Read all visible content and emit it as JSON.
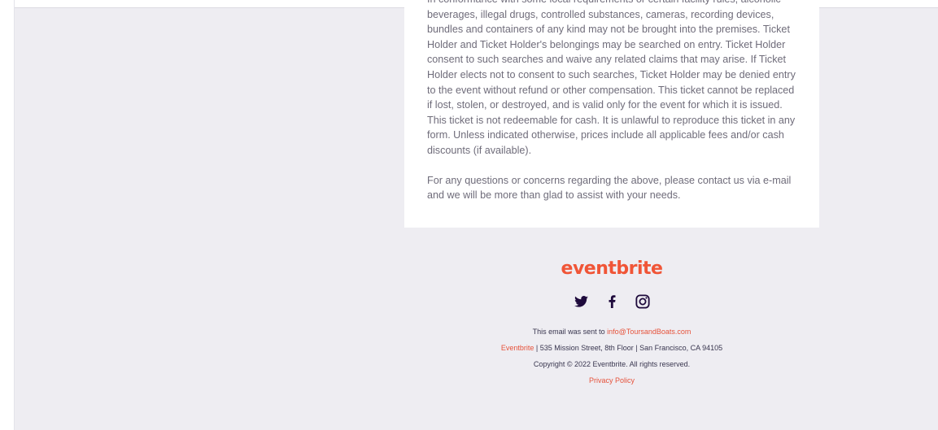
{
  "terms": {
    "paragraph1": "In conformance with some local requirements or certain facility rules, alcoholic beverages, illegal drugs, controlled substances, cameras, recording devices, bundles and containers of any kind may not be brought into the premises. Ticket Holder and Ticket Holder's belongings may be searched on entry. Ticket Holder consent to such searches and waive any related claims that may arise. If Ticket Holder elects not to consent to such searches, Ticket Holder may be denied entry to the event without refund or other compensation. This ticket cannot be replaced if lost, stolen, or destroyed, and is valid only for the event for which it is issued. This ticket is not redeemable for cash. It is unlawful to reproduce this ticket in any form. Unless indicated otherwise, prices include all applicable fees and/or cash discounts (if available).",
    "paragraph2": "For any questions or concerns regarding the above, please contact us via e-mail and we will be more than glad to assist with your needs."
  },
  "footer": {
    "logo_text": "eventbrite",
    "social": [
      {
        "icon": "twitter-icon"
      },
      {
        "icon": "facebook-icon"
      },
      {
        "icon": "instagram-icon"
      }
    ],
    "sent_to_prefix": "This email was sent to ",
    "sent_to_email": "info@ToursandBoats.com",
    "company_link": "Eventbrite",
    "address": " | 535 Mission Street, 8th Floor | San Francisco, CA 94105",
    "copyright": "Copyright © 2022 Eventbrite. All rights reserved.",
    "privacy_link": "Privacy Policy"
  },
  "colors": {
    "brand": "#f05537",
    "link": "#e6523b",
    "background": "#eeedf2",
    "body_text": "#6f6c7a",
    "icon": "#1e0a3c"
  }
}
